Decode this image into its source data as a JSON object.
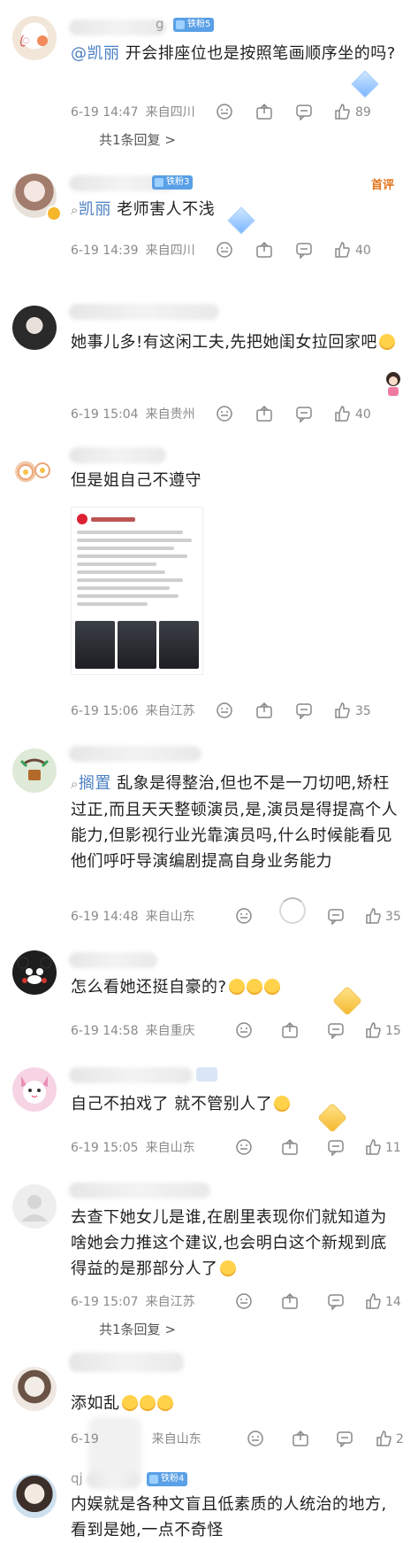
{
  "comments": [
    {
      "name_visible": "g",
      "badge": "铁粉5",
      "text_mention": "@凯丽",
      "text": " 开会排座位也是按照笔画顺序坐的吗?",
      "date": "6-19 14:47",
      "location": "来自四川",
      "likes": "89",
      "replies": "共1条回复",
      "replies_arrow": ">"
    },
    {
      "badge": "铁粉3",
      "text_mention": "凯丽",
      "text": " 老师害人不浅",
      "date": "6-19 14:39",
      "location": "来自四川",
      "likes": "40",
      "top_tag": "首评"
    },
    {
      "text": "她事儿多!有这闲工夫,先把她闺女拉回家吧",
      "date": "6-19 15:04",
      "location": "来自贵州",
      "likes": "40"
    },
    {
      "text": "但是姐自己不遵守",
      "date": "6-19 15:06",
      "location": "来自江苏",
      "likes": "35"
    },
    {
      "text_mention": "搁置",
      "text": " 乱象是得整治,但也不是一刀切吧,矫枉过正,而且天天整顿演员,是,演员是得提高个人能力,但影视行业光靠演员吗,什么时候能看见他们呼吁导演编剧提高自身业务能力",
      "date": "6-19 14:48",
      "location": "来自山东",
      "likes": "35"
    },
    {
      "text": "怎么看她还挺自豪的?",
      "date": "6-19 14:58",
      "location": "来自重庆",
      "likes": "15"
    },
    {
      "text": "自己不拍戏了 就不管别人了",
      "date": "6-19 15:05",
      "location": "来自山东",
      "likes": "11"
    },
    {
      "text": "去查下她女儿是谁,在剧里表现你们就知道为啥她会力推这个建议,也会明白这个新规到底得益的是那部分人了",
      "date": "6-19 15:07",
      "location": "来自江苏",
      "likes": "14",
      "replies": "共1条回复",
      "replies_arrow": ">"
    },
    {
      "text": "添如乱",
      "date": "6-19",
      "location": "来自山东",
      "likes": "2"
    },
    {
      "name_visible": "qj",
      "badge": "铁粉4",
      "text": "内娱就是各种文盲且低素质的人统治的地方,看到是她,一点不奇怪"
    }
  ],
  "colors": {
    "mention": "#4a7fc1",
    "meta": "#8a8a8a",
    "badge": "#5aa0e6",
    "top_tag": "#e2741b"
  },
  "icons": [
    "dislike-icon",
    "share-icon",
    "comment-icon",
    "like-icon"
  ]
}
